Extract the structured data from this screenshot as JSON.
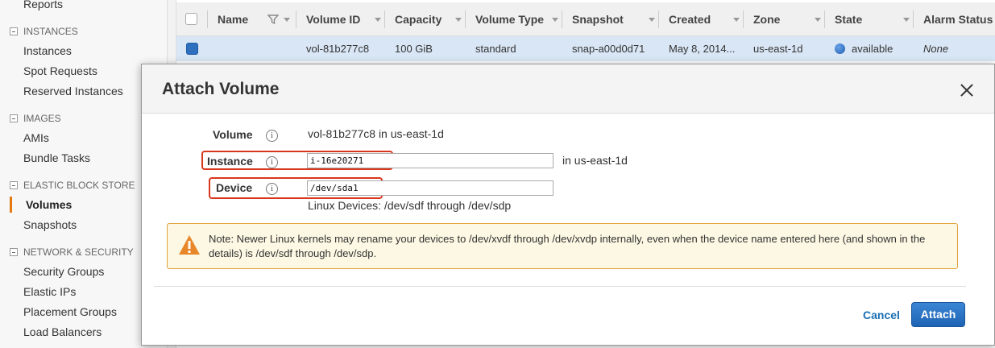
{
  "sidebar": {
    "top_item": "Reports",
    "sections": [
      {
        "header": "INSTANCES",
        "items": [
          "Instances",
          "Spot Requests",
          "Reserved Instances"
        ]
      },
      {
        "header": "IMAGES",
        "items": [
          "AMIs",
          "Bundle Tasks"
        ]
      },
      {
        "header": "ELASTIC BLOCK STORE",
        "items": [
          "Volumes",
          "Snapshots"
        ]
      },
      {
        "header": "NETWORK & SECURITY",
        "items": [
          "Security Groups",
          "Elastic IPs",
          "Placement Groups",
          "Load Balancers"
        ]
      }
    ],
    "active_item": "Volumes",
    "accent_color": "#e47911"
  },
  "table": {
    "columns": [
      "Name",
      "Volume ID",
      "Capacity",
      "Volume Type",
      "Snapshot",
      "Created",
      "Zone",
      "State",
      "Alarm Status"
    ],
    "row": {
      "name": "",
      "volume_id": "vol-81b277c8",
      "capacity": "100 GiB",
      "volume_type": "standard",
      "snapshot": "snap-a00d0d71",
      "created": "May 8, 2014...",
      "zone": "us-east-1d",
      "state": "available",
      "alarm_status": "None",
      "selected": true
    }
  },
  "modal": {
    "title": "Attach Volume",
    "fields": {
      "volume": {
        "label": "Volume",
        "value": "vol-81b277c8 in us-east-1d"
      },
      "instance": {
        "label": "Instance",
        "value": "i-16e20271",
        "suffix": "in us-east-1d"
      },
      "device": {
        "label": "Device",
        "value": "/dev/sda1",
        "hint": "Linux Devices: /dev/sdf through /dev/sdp"
      }
    },
    "info_glyph": "i",
    "note": "Note: Newer Linux kernels may rename your devices to /dev/xvdf through /dev/xvdp internally, even when the device name entered here (and shown in the details) is /dev/sdf through /dev/sdp.",
    "cancel_label": "Cancel",
    "attach_label": "Attach",
    "highlight_color": "#d9361e"
  }
}
